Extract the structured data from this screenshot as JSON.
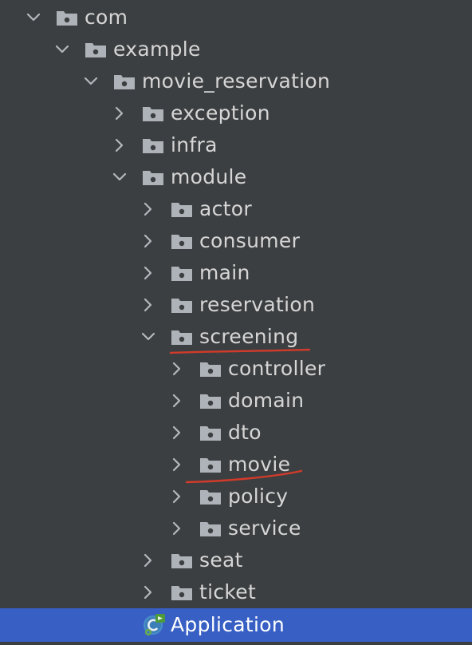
{
  "tree": [
    {
      "label": "com",
      "depth": 0,
      "expanded": true,
      "type": "package"
    },
    {
      "label": "example",
      "depth": 1,
      "expanded": true,
      "type": "package"
    },
    {
      "label": "movie_reservation",
      "depth": 2,
      "expanded": true,
      "type": "package"
    },
    {
      "label": "exception",
      "depth": 3,
      "expanded": false,
      "type": "package"
    },
    {
      "label": "infra",
      "depth": 3,
      "expanded": false,
      "type": "package"
    },
    {
      "label": "module",
      "depth": 3,
      "expanded": true,
      "type": "package"
    },
    {
      "label": "actor",
      "depth": 4,
      "expanded": false,
      "type": "package"
    },
    {
      "label": "consumer",
      "depth": 4,
      "expanded": false,
      "type": "package"
    },
    {
      "label": "main",
      "depth": 4,
      "expanded": false,
      "type": "package"
    },
    {
      "label": "reservation",
      "depth": 4,
      "expanded": false,
      "type": "package"
    },
    {
      "label": "screening",
      "depth": 4,
      "expanded": true,
      "type": "package"
    },
    {
      "label": "controller",
      "depth": 5,
      "expanded": false,
      "type": "package"
    },
    {
      "label": "domain",
      "depth": 5,
      "expanded": false,
      "type": "package"
    },
    {
      "label": "dto",
      "depth": 5,
      "expanded": false,
      "type": "package"
    },
    {
      "label": "movie",
      "depth": 5,
      "expanded": false,
      "type": "package"
    },
    {
      "label": "policy",
      "depth": 5,
      "expanded": false,
      "type": "package"
    },
    {
      "label": "service",
      "depth": 5,
      "expanded": false,
      "type": "package"
    },
    {
      "label": "seat",
      "depth": 4,
      "expanded": false,
      "type": "package"
    },
    {
      "label": "ticket",
      "depth": 4,
      "expanded": false,
      "type": "package"
    },
    {
      "label": "Application",
      "depth": 4,
      "type": "spring-boot-class",
      "selected": true
    }
  ],
  "annotations": [
    {
      "target": "screening",
      "color": "#d23b2b"
    },
    {
      "target": "movie",
      "color": "#d23b2b"
    }
  ],
  "colors": {
    "background": "#3c3f41",
    "selection": "#375fc4",
    "folder": "#adb3b8",
    "text": "#d6d6d6",
    "annotation": "#d23b2b"
  }
}
